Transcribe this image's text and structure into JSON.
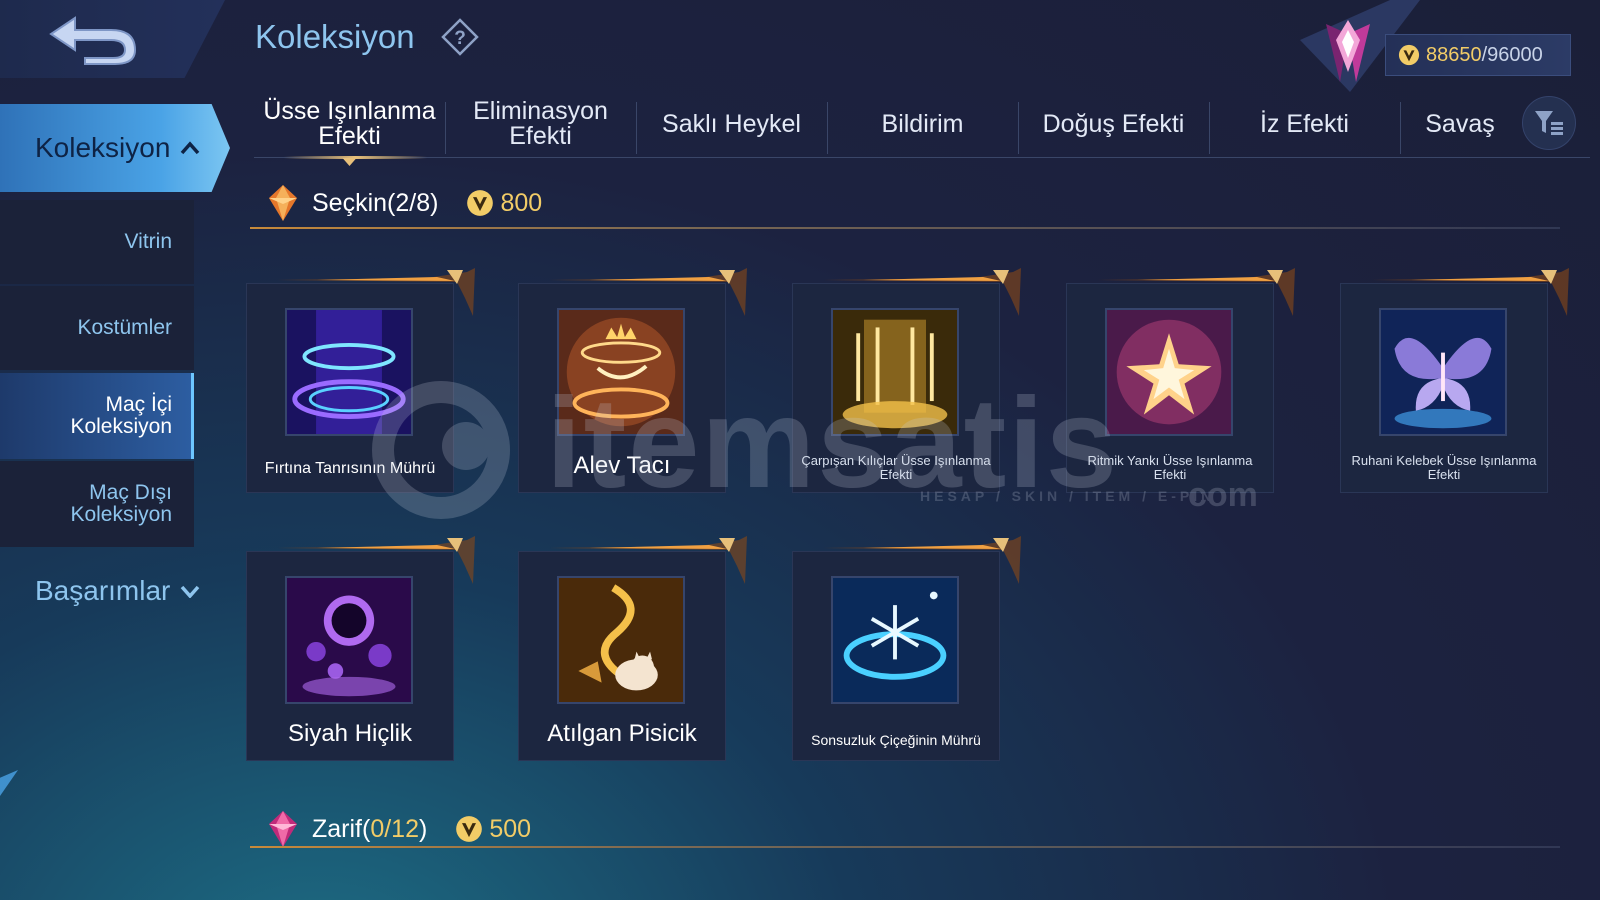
{
  "header": {
    "title": "Koleksiyon",
    "help_icon": "question-diamond-icon",
    "currency": {
      "current": "88650",
      "max": "/96000",
      "icon": "coin-icon"
    }
  },
  "sidebar": {
    "main": "Koleksiyon",
    "items": [
      {
        "label": "Vitrin"
      },
      {
        "label": "Kostümler"
      },
      {
        "label": "Maç İçi Koleksiyon",
        "active": true
      },
      {
        "label": "Maç Dışı Koleksiyon"
      }
    ],
    "achievements": "Başarımlar"
  },
  "tabs": [
    {
      "label": "Üsse Işınlanma Efekti",
      "active": true
    },
    {
      "label": "Eliminasyon Efekti"
    },
    {
      "label": "Saklı Heykel"
    },
    {
      "label": "Bildirim"
    },
    {
      "label": "Doğuş Efekti"
    },
    {
      "label": "İz Efekti"
    },
    {
      "label": "Savaş"
    }
  ],
  "sections": [
    {
      "title": "Seçkin(2/8)",
      "cost": "800",
      "items": [
        {
          "name": "Fırtına Tanrısının Mührü"
        },
        {
          "name": "Alev Tacı"
        },
        {
          "name": "Çarpışan Kılıçlar Üsse Işınlanma Efekti"
        },
        {
          "name": "Ritmik Yankı Üsse Işınlanma Efekti"
        },
        {
          "name": "Ruhani Kelebek Üsse Işınlanma Efekti"
        },
        {
          "name": "Siyah Hiçlik"
        },
        {
          "name": "Atılgan Pisicik"
        },
        {
          "name": "Sonsuzluk Çiçeğinin Mührü"
        }
      ]
    },
    {
      "title_prefix": "Zarif(",
      "title_count": "0/12",
      "title_suffix": ")",
      "cost": "500"
    }
  ],
  "watermark": {
    "brand": "itemsatis",
    "tagline": "HESAP / SKIN / ITEM / E-PIN",
    "suffix": "com"
  },
  "colors": {
    "accent_gold": "#f2cc67",
    "accent_blue": "#8ec5ee",
    "active_tab_underline": "#e8c07a"
  }
}
